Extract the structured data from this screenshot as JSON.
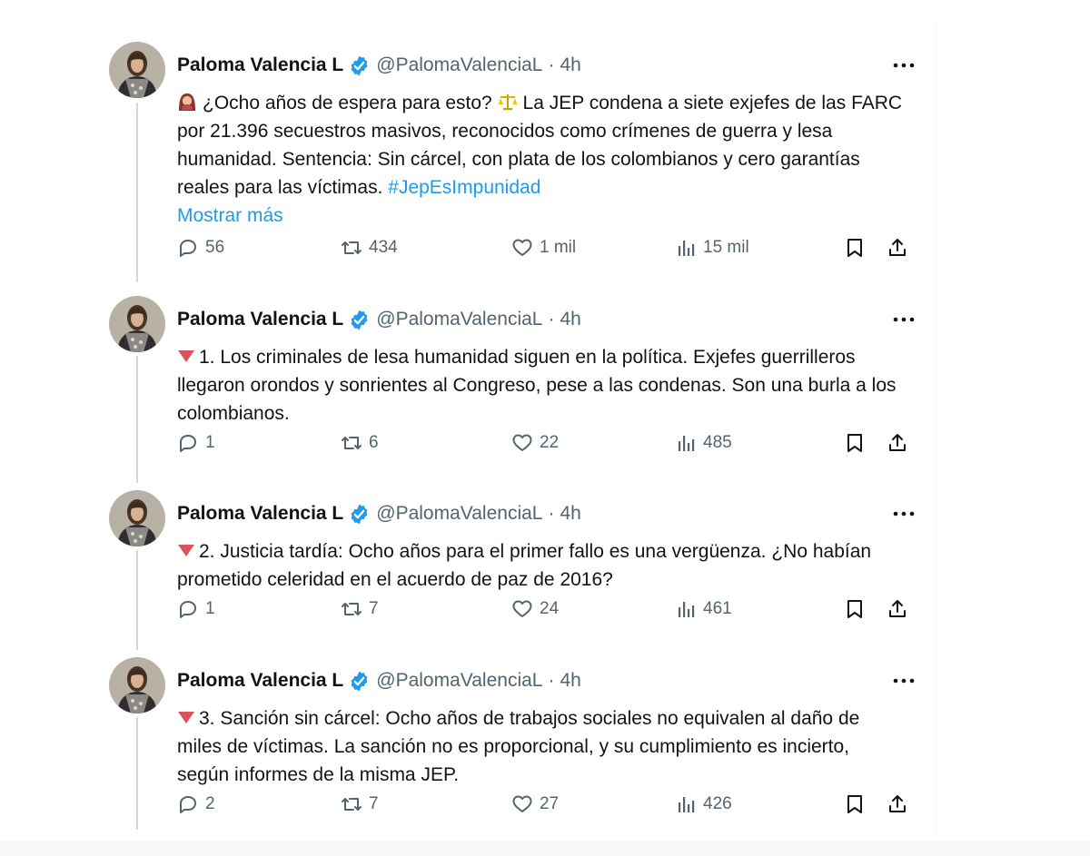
{
  "colors": {
    "text": "#0f1419",
    "muted": "#536471",
    "link": "#1d9bf0",
    "verified": "#1d9bf0",
    "thread_line": "#cfd9de"
  },
  "tweets": [
    {
      "author": {
        "name": "Paloma Valencia L",
        "handle": "@PalomaValenciaL",
        "separator": "·",
        "time": "4h",
        "verified_icon": "verified-badge-icon",
        "avatar_icon": "avatar"
      },
      "lead_icon": "woman-emoji-icon",
      "text_part1": "¿Ocho años de espera para esto?",
      "text_icon": "scales-emoji-icon",
      "text_part2": "La JEP condena a siete exjefes de las FARC por 21.396 secuestros masivos, reconocidos como crímenes de guerra y lesa humanidad. Sentencia: Sin cárcel, con plata de los colombianos y cero garantías reales para las víctimas.",
      "hashtag": "#JepEsImpunidad",
      "show_more": "Mostrar más",
      "stats": {
        "replies": "56",
        "reposts": "434",
        "likes": "1 mil",
        "views": "15 mil"
      }
    },
    {
      "author": {
        "name": "Paloma Valencia L",
        "handle": "@PalomaValenciaL",
        "separator": "·",
        "time": "4h"
      },
      "marker_icon": "red-triangle-down-icon",
      "text": "1. Los criminales de lesa humanidad siguen en la política. Exjefes guerrilleros llegaron orondos y sonrientes al Congreso, pese a las condenas. Son una burla a los colombianos.",
      "stats": {
        "replies": "1",
        "reposts": "6",
        "likes": "22",
        "views": "485"
      }
    },
    {
      "author": {
        "name": "Paloma Valencia L",
        "handle": "@PalomaValenciaL",
        "separator": "·",
        "time": "4h"
      },
      "marker_icon": "red-triangle-down-icon",
      "text": "2. Justicia tardía: Ocho años para el primer fallo es una vergüenza. ¿No habían prometido celeridad en el acuerdo de paz de 2016?",
      "stats": {
        "replies": "1",
        "reposts": "7",
        "likes": "24",
        "views": "461"
      }
    },
    {
      "author": {
        "name": "Paloma Valencia L",
        "handle": "@PalomaValenciaL",
        "separator": "·",
        "time": "4h"
      },
      "marker_icon": "red-triangle-down-icon",
      "text": "3. Sanción sin cárcel: Ocho años de trabajos sociales no equivalen al daño de miles de víctimas. La sanción no es proporcional, y su cumplimiento es incierto, según informes de la misma JEP.",
      "stats": {
        "replies": "2",
        "reposts": "7",
        "likes": "27",
        "views": "426"
      }
    }
  ]
}
